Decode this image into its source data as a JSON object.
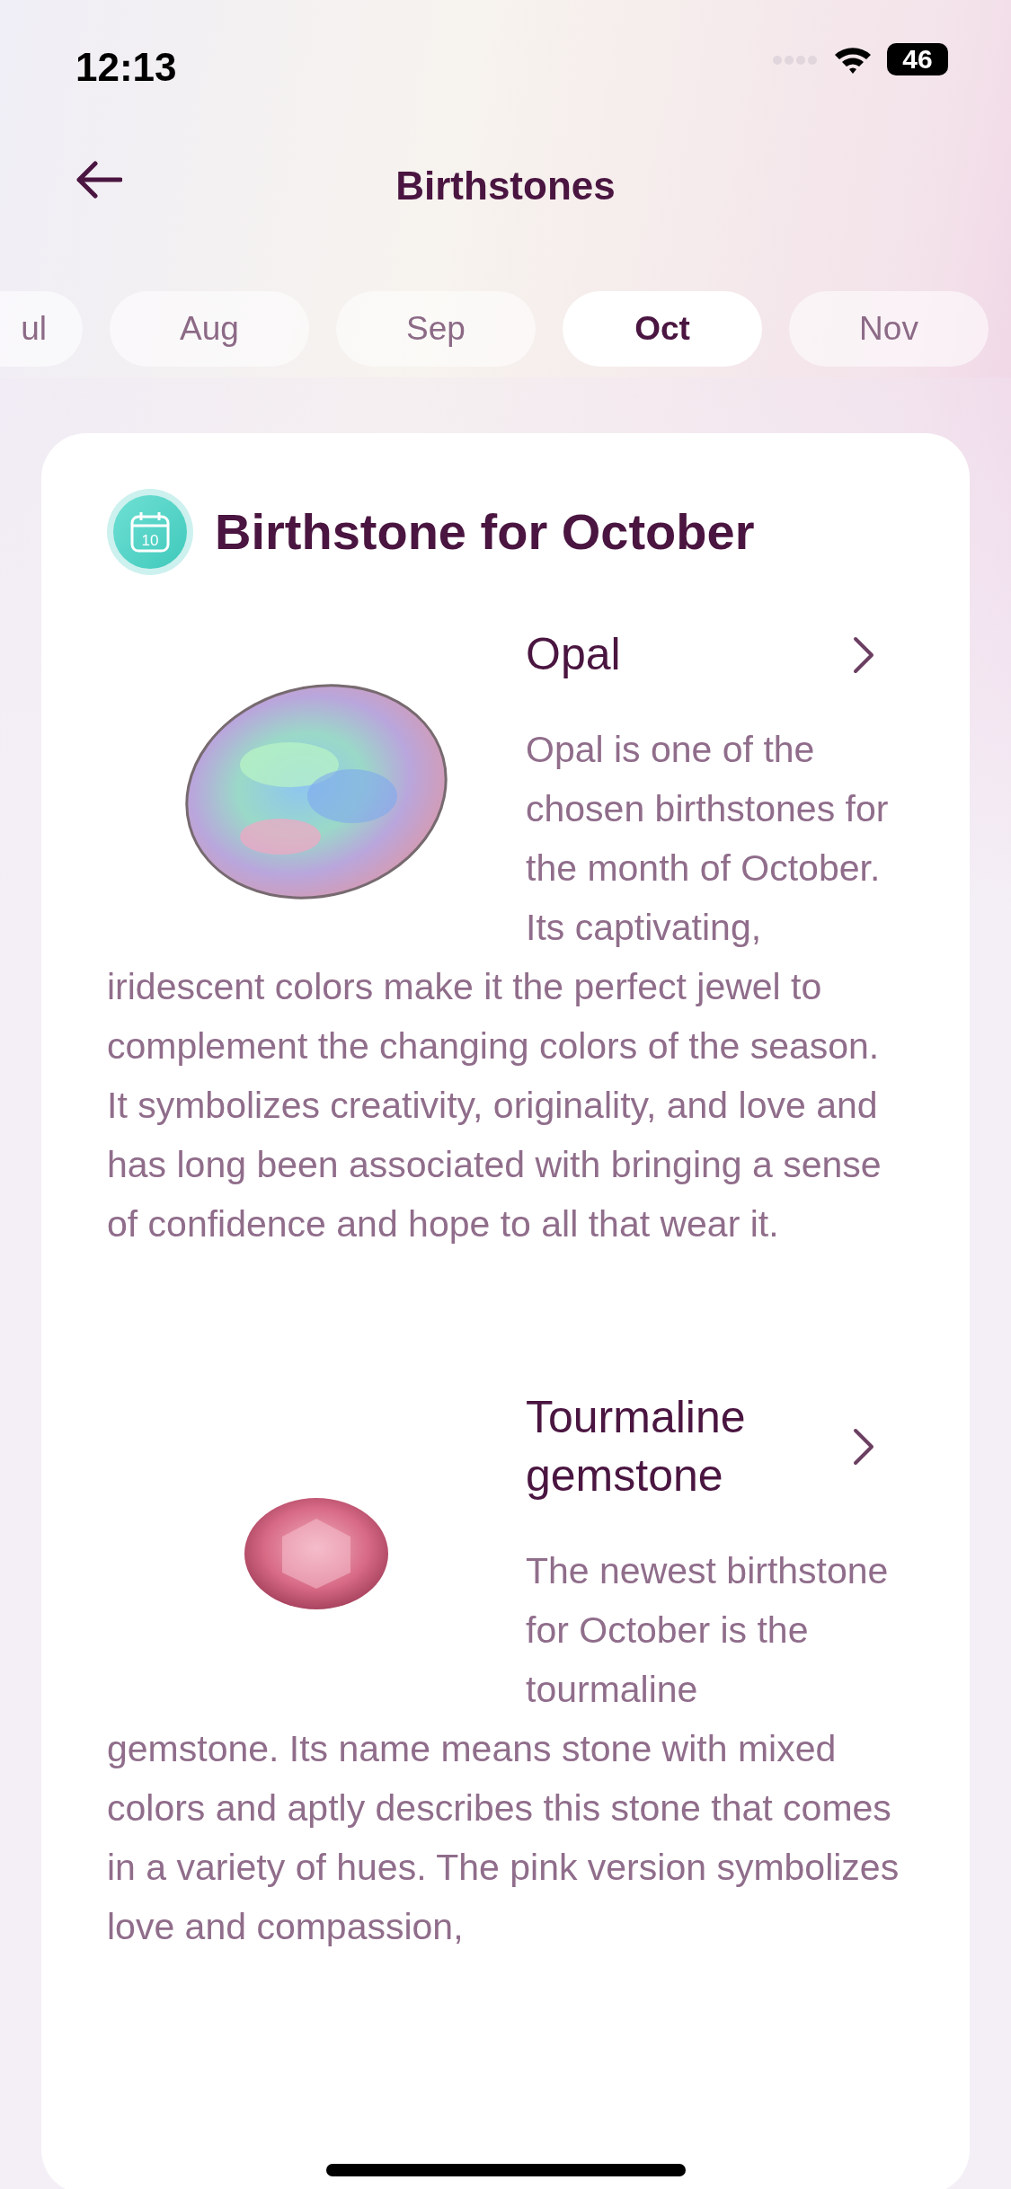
{
  "status_bar": {
    "time": "12:13",
    "battery": "46"
  },
  "header": {
    "title": "Birthstones"
  },
  "months": [
    {
      "label": "ul",
      "selected": false
    },
    {
      "label": "Aug",
      "selected": false
    },
    {
      "label": "Sep",
      "selected": false
    },
    {
      "label": "Oct",
      "selected": true
    },
    {
      "label": "Nov",
      "selected": false
    }
  ],
  "card": {
    "title": "Birthstone for October",
    "calendar_day": "10",
    "stones": [
      {
        "kind": "opal",
        "name": "Opal",
        "description": [
          "Opal is one of the chosen birthstones for the month of October. Its captivating,",
          "iridescent colors make it the perfect jewel to complement the changing colors of the season. It symbolizes creativity, originality, and love and has long been associated with bringing a sense of confidence and hope to all that wear it."
        ]
      },
      {
        "kind": "tourmaline",
        "name": "Tourmaline gemstone",
        "description": [
          "The newest birthstone for October is the tourmaline",
          "gemstone. Its name means stone with mixed colors and aptly describes this stone that comes in a variety of hues. The pink version symbolizes love and compassion,"
        ]
      }
    ]
  }
}
